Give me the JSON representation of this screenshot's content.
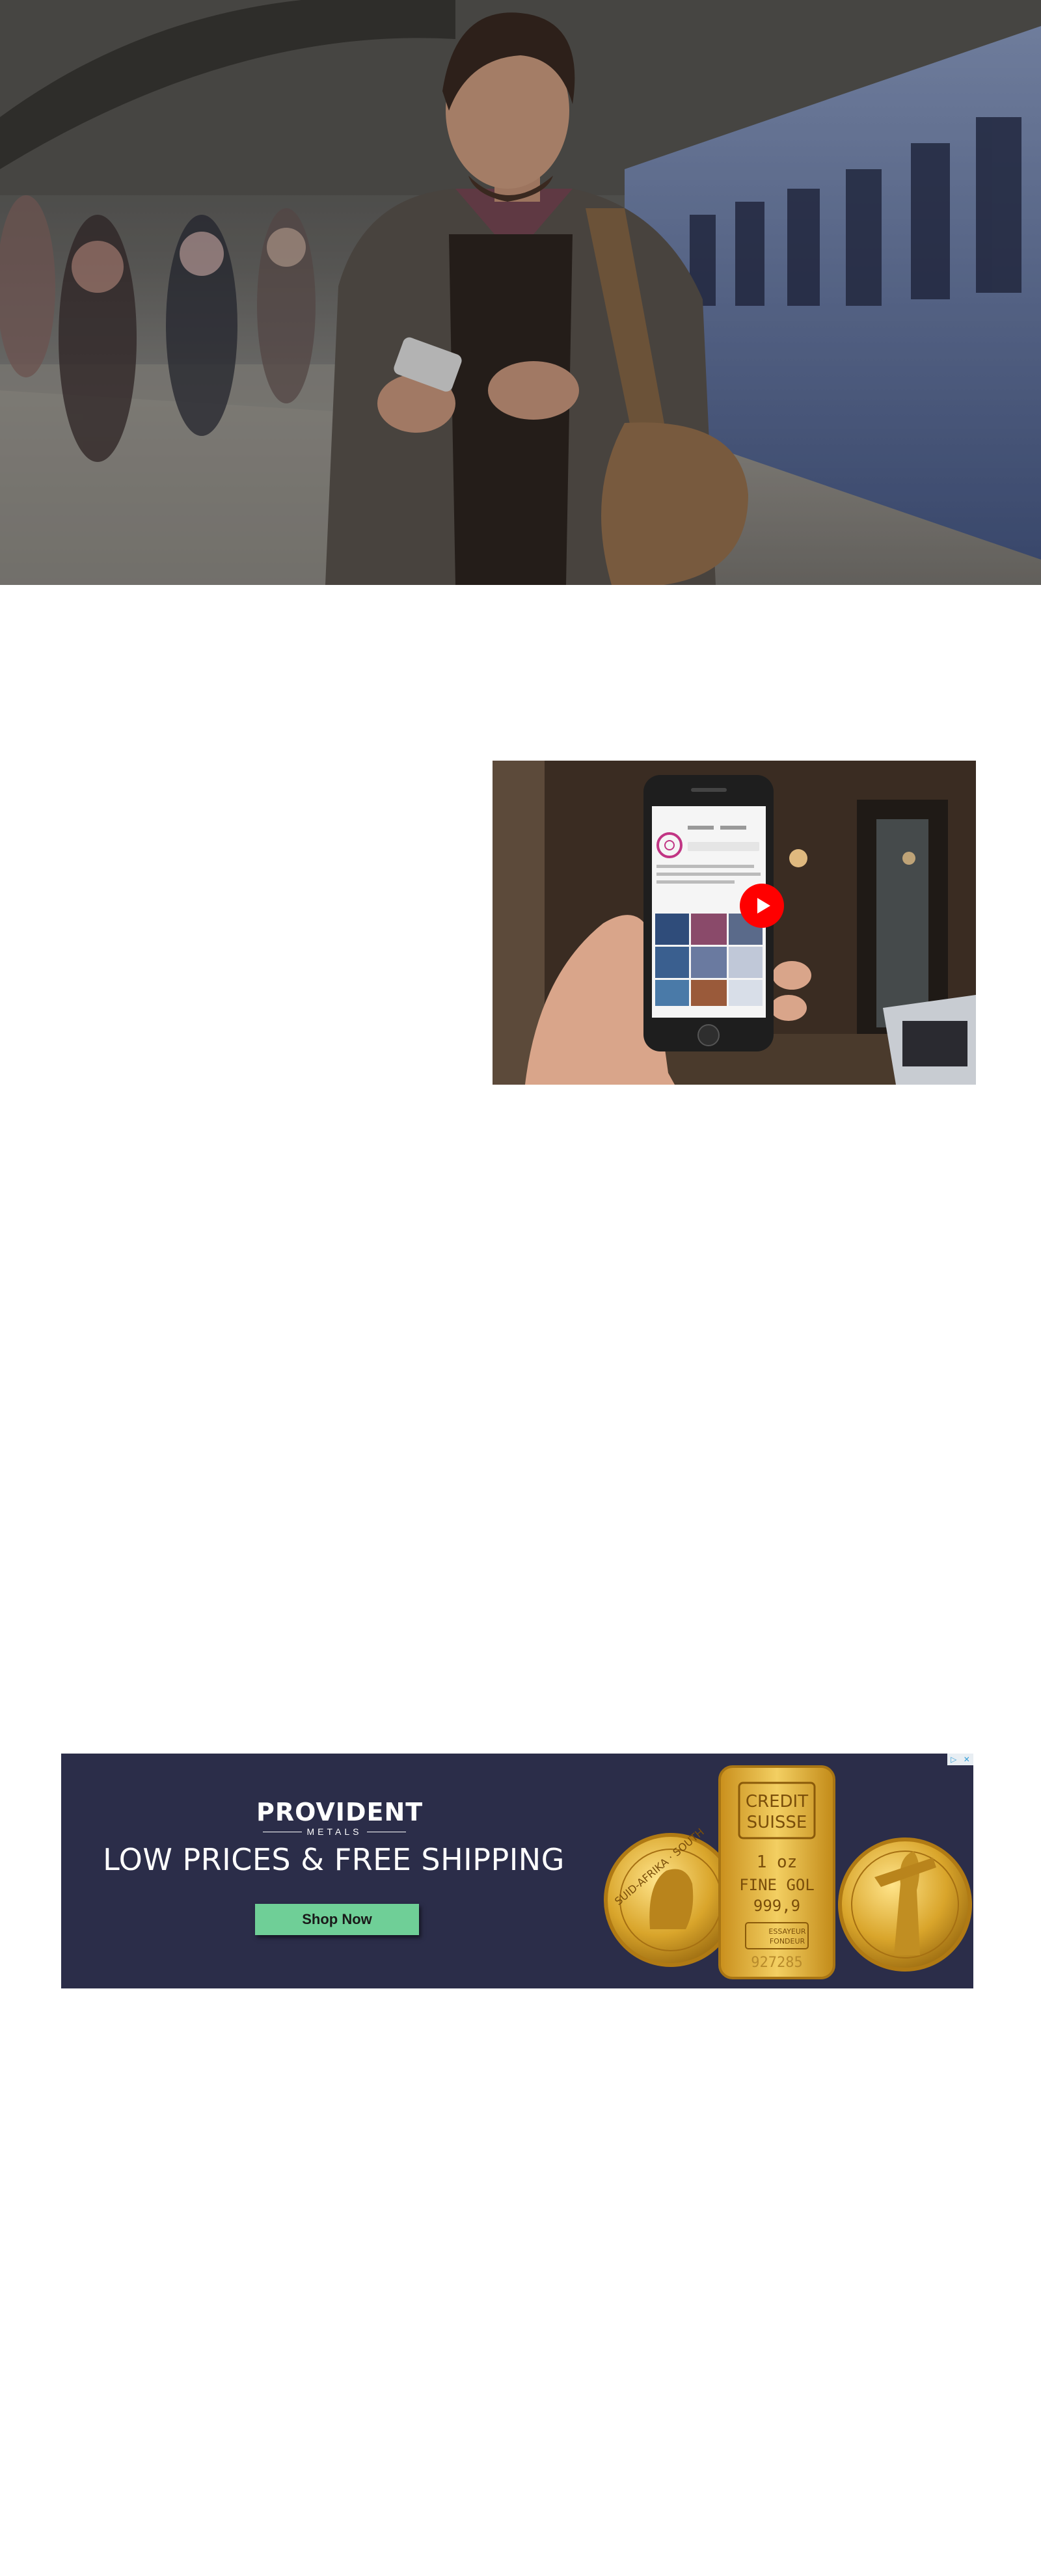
{
  "hero": {
    "image": "man-using-smartphone-at-train-station-photo"
  },
  "video": {
    "thumbnail": "hand-holding-phone-with-instagram-profile-photo",
    "play_icon": "play-icon"
  },
  "ad": {
    "brand": "PROVIDENT",
    "brand_sub": "METALS",
    "headline": "LOW PRICES & FREE SHIPPING",
    "cta": "Shop Now",
    "bar_text_1": "CREDIT",
    "bar_text_2": "SUISSE",
    "bar_weight": "1 oz",
    "bar_purity_1": "FINE GOL",
    "bar_purity_2": "999,9",
    "bar_assayer_1": "ESSAYEUR",
    "bar_assayer_2": "FONDEUR",
    "bar_serial": "927285",
    "coin_left_text": "SUID-AFRIKA · SOUTH",
    "adchoices_icon": "adchoices-icon",
    "close_icon": "close-icon",
    "colors": {
      "background": "#2b2d49",
      "button": "#6fcf97",
      "gold": "#d4a52a"
    }
  }
}
